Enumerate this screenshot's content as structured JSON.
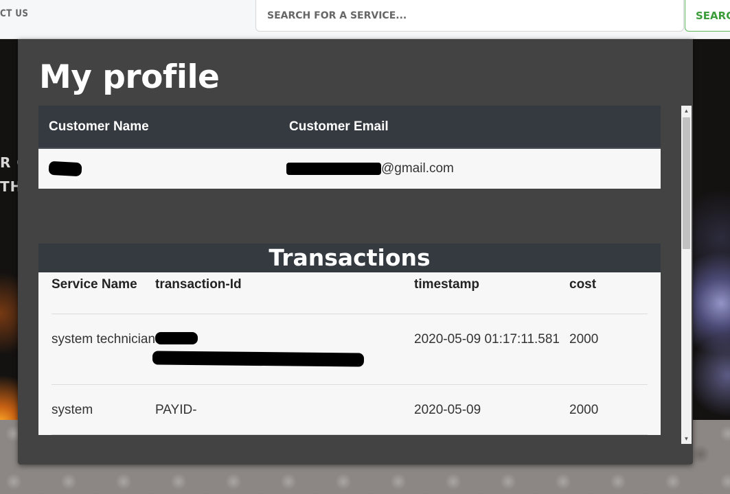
{
  "header": {
    "nav_contact": "CT US",
    "search_placeholder": "SEARCH FOR A SERVICE...",
    "search_button": "SEARCH"
  },
  "hero": {
    "line1": "R C",
    "line2": "TH"
  },
  "modal": {
    "title": "My profile",
    "customer_table": {
      "headers": [
        "Customer Name",
        "Customer Email"
      ],
      "row": {
        "name": "",
        "email_suffix": "@gmail.com"
      }
    },
    "transactions": {
      "title": "Transactions",
      "headers": {
        "service": "Service Name",
        "tid": "transaction-Id",
        "timestamp": "timestamp",
        "cost": "cost"
      },
      "rows": [
        {
          "service": "system technician",
          "tid": "",
          "timestamp": "2020-05-09 01:17:11.581",
          "cost": "2000"
        },
        {
          "service": "system",
          "tid": "PAYID-",
          "timestamp": "2020-05-09",
          "cost": "2000"
        }
      ]
    }
  }
}
